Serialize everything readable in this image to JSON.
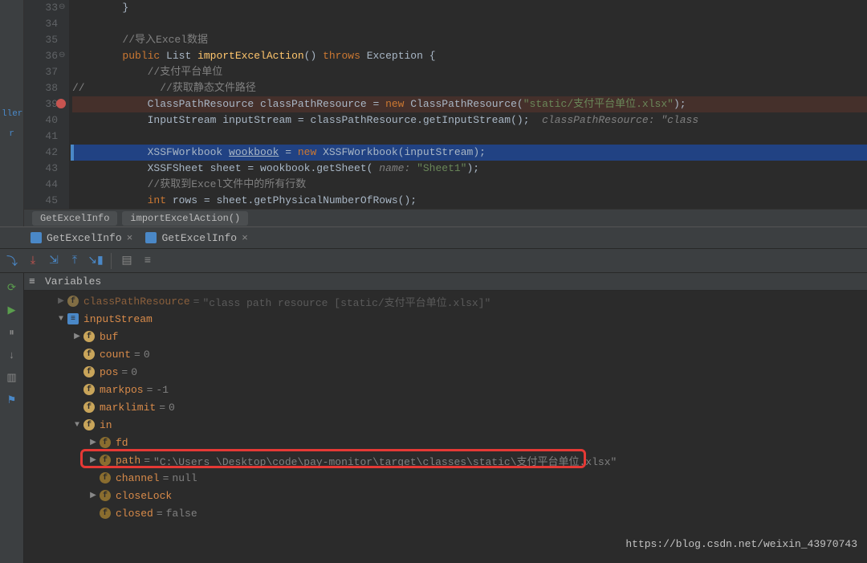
{
  "leftPanel": {
    "btn1": "ller",
    "btn2": "r"
  },
  "lines": [
    "33",
    "34",
    "35",
    "36",
    "37",
    "38",
    "39",
    "40",
    "41",
    "42",
    "43",
    "44",
    "45"
  ],
  "code": {
    "l33": "        }",
    "l35_c": "        //导入Excel数据",
    "l36_pre": "        ",
    "l36_k1": "public",
    "l36_sp": " List ",
    "l36_m": "importExcelAction",
    "l36_p": "() ",
    "l36_k2": "throws",
    "l36_ex": " Exception {",
    "l37_c": "            //支付平台单位",
    "l38_pre": "//",
    "l38_c": "            //获取静态文件路径",
    "l39_pre": "            ClassPathResource classPathResource = ",
    "l39_k": "new",
    "l39_cls": " ClassPathResource(",
    "l39_s": "\"static/支付平台单位.xlsx\"",
    "l39_end": ");",
    "l40_pre": "            InputStream inputStream = classPathResource.getInputStream();  ",
    "l40_ci": "classPathResource: \"class",
    "l42_pre": "            XSSFWorkbook ",
    "l42_u": "wookbook",
    "l42_eq": " = ",
    "l42_k": "new",
    "l42_cls": " XSSFWorkbook(inputStream);",
    "l43_pre": "            XSSFSheet sheet = wookbook.getSheet( ",
    "l43_hint": "name: ",
    "l43_s": "\"Sheet1\"",
    "l43_end": ");",
    "l44_c": "            //获取到Excel文件中的所有行数",
    "l45_pre": "            ",
    "l45_k": "int",
    "l45_rest": " rows = sheet.getPhysicalNumberOfRows();"
  },
  "breadcrumb": {
    "a": "GetExcelInfo",
    "b": "importExcelAction()"
  },
  "debugTabs": {
    "t1": "GetExcelInfo",
    "t2": "GetExcelInfo"
  },
  "varTitle": "Variables",
  "variables": {
    "r0_name": "classPathResource",
    "r0_val": "\"class path resource [static/支付平台单位.xlsx]\"",
    "r1_name": "inputStream",
    "r2_name": "buf",
    "r3_name": "count",
    "r3_val": "0",
    "r4_name": "pos",
    "r4_val": "0",
    "r5_name": "markpos",
    "r5_val": "-1",
    "r6_name": "marklimit",
    "r6_val": "0",
    "r7_name": "in",
    "r8_name": "fd",
    "r9_name": "path",
    "r9_val": "\"C:\\Users          \\Desktop\\code\\pay-monitor\\target\\classes\\static\\支付平台单位.xlsx\"",
    "r10_name": "channel",
    "r10_val": "null",
    "r11_name": "closeLock",
    "r12_name": "closed",
    "r12_val": "false"
  },
  "watermark": "https://blog.csdn.net/weixin_43970743"
}
